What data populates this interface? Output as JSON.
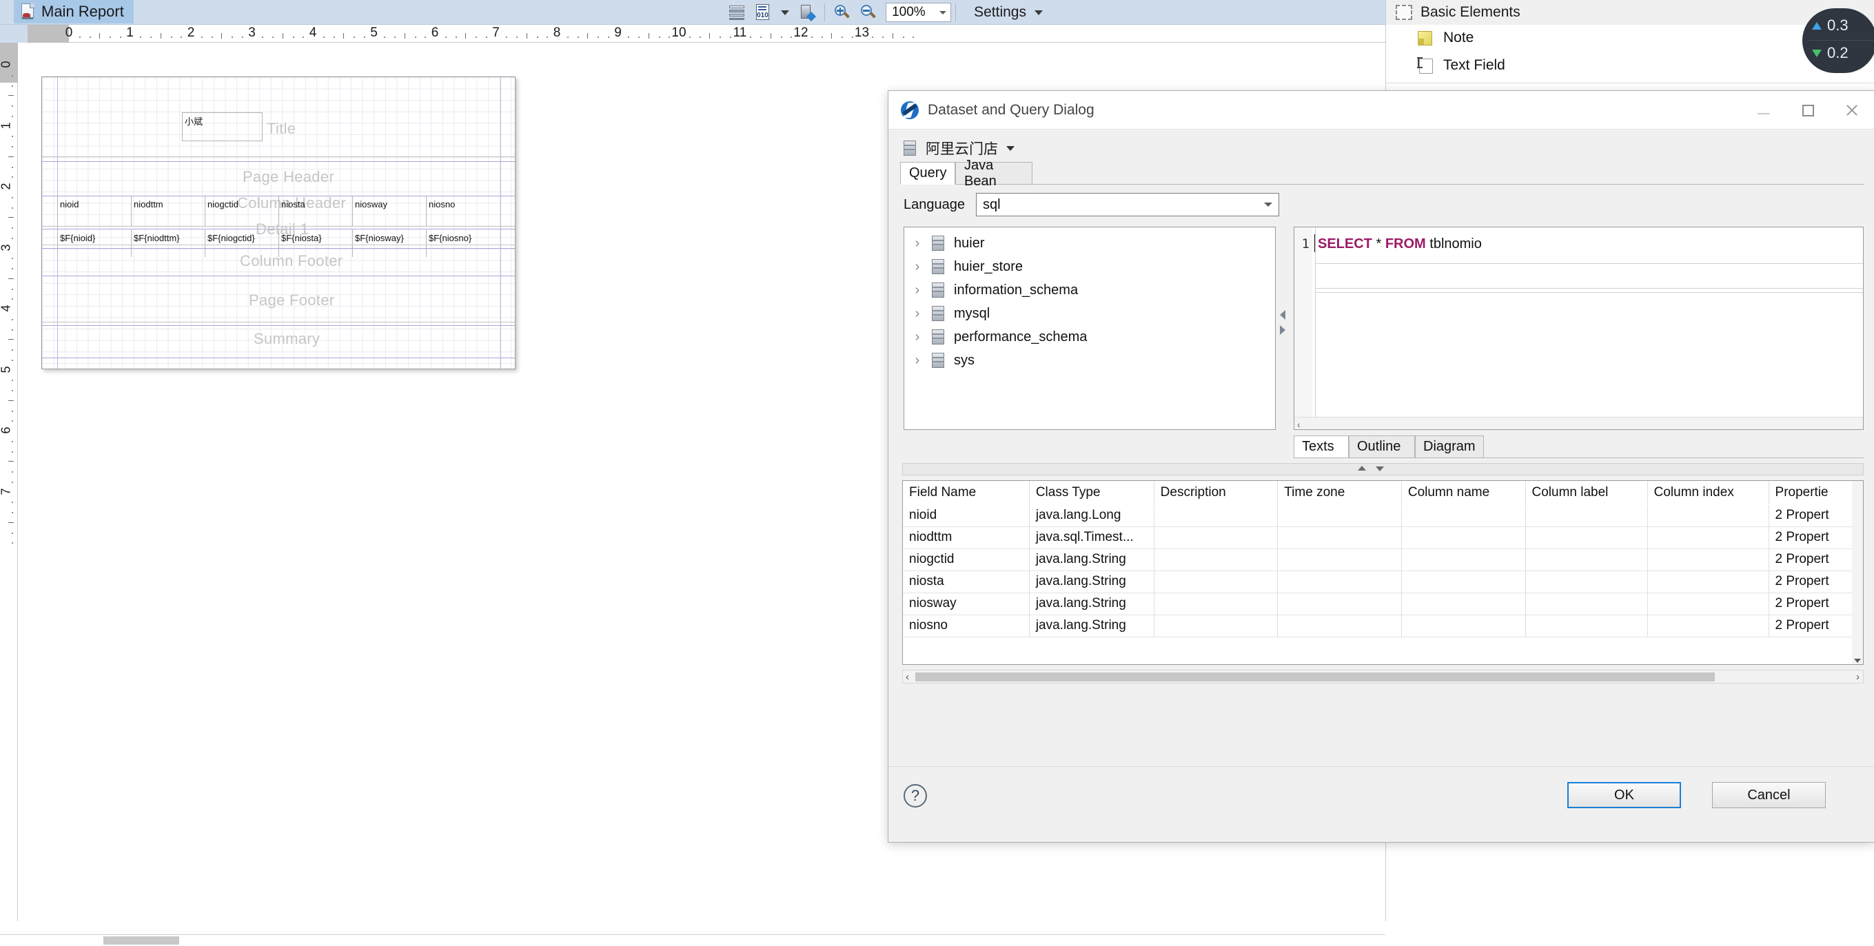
{
  "topbar": {
    "doc_tab_label": "Main Report",
    "doc_tab_icon": "report-document-icon",
    "toolbar_icons": [
      "dataset-rows-icon",
      "data-binary-icon",
      "dropdown-caret-icon",
      "server-edit-icon",
      "zoom-in-icon",
      "zoom-out-icon"
    ],
    "zoom_value": "100%",
    "settings_label": "Settings"
  },
  "designer": {
    "h_ruler_numbers": [
      "0",
      "1",
      "2",
      "3",
      "4",
      "5",
      "6",
      "7",
      "8",
      "9",
      "10",
      "11",
      "12",
      "13"
    ],
    "v_ruler_numbers": [
      "0",
      "1",
      "2",
      "3",
      "4",
      "5",
      "6",
      "7"
    ],
    "bands": [
      {
        "name": "Title",
        "label": "Title"
      },
      {
        "name": "Page Header",
        "label": "Page Header"
      },
      {
        "name": "Column Header",
        "label": "Column Header"
      },
      {
        "name": "Detail 1",
        "label": "Detail 1"
      },
      {
        "name": "Column Footer",
        "label": "Column Footer"
      },
      {
        "name": "Page Footer",
        "label": "Page Footer"
      },
      {
        "name": "Summary",
        "label": "Summary"
      }
    ],
    "title_textbox_value": "小斌",
    "column_headers": [
      "nioid",
      "niodttm",
      "niogctid",
      "niosta",
      "niosway",
      "niosno"
    ],
    "detail_fields": [
      "$F{nioid}",
      "$F{niodttm}",
      "$F{niogctid}",
      "$F{niosta}",
      "$F{niosway}",
      "$F{niosno}"
    ]
  },
  "palette": {
    "section_label": "Basic Elements",
    "section_icon": "dashed-rectangle-icon",
    "items": [
      {
        "label": "Note",
        "icon": "sticky-note-icon"
      },
      {
        "label": "Text Field",
        "icon": "text-field-icon"
      }
    ]
  },
  "net_widget": {
    "upload": "0.3",
    "download": "0.2",
    "up_icon": "arrow-up-icon",
    "down_icon": "arrow-down-icon"
  },
  "dialog": {
    "title": "Dataset and Query Dialog",
    "title_icon": "jasperreports-icon",
    "window_buttons": [
      "minimize-icon",
      "maximize-icon",
      "close-icon"
    ],
    "datasource": {
      "name": "阿里云门店",
      "icon": "database-icon"
    },
    "tabs": [
      {
        "label": "Query",
        "active": true
      },
      {
        "label": "Java Bean",
        "active": false
      }
    ],
    "language": {
      "label": "Language",
      "value": "sql"
    },
    "tree": [
      {
        "label": "huier"
      },
      {
        "label": "huier_store"
      },
      {
        "label": "information_schema"
      },
      {
        "label": "mysql"
      },
      {
        "label": "performance_schema"
      },
      {
        "label": "sys"
      }
    ],
    "sql": {
      "line_number": "1",
      "keyword1": "SELECT",
      "star": " * ",
      "keyword2": "FROM",
      "table": " tblnomio"
    },
    "lower_tabs": [
      {
        "label": "Texts",
        "active": true
      },
      {
        "label": "Outline",
        "active": false
      },
      {
        "label": "Diagram",
        "active": false
      }
    ],
    "field_table": {
      "columns": [
        "Field Name",
        "Class Type",
        "Description",
        "Time zone",
        "Column name",
        "Column label",
        "Column index",
        "Propertie"
      ],
      "rows": [
        {
          "field_name": "nioid",
          "class_type": "java.lang.Long",
          "description": "",
          "time_zone": "",
          "column_name": "",
          "column_label": "",
          "column_index": "",
          "properties": "2 Propert"
        },
        {
          "field_name": "niodttm",
          "class_type": "java.sql.Timest...",
          "description": "",
          "time_zone": "",
          "column_name": "",
          "column_label": "",
          "column_index": "",
          "properties": "2 Propert"
        },
        {
          "field_name": "niogctid",
          "class_type": "java.lang.String",
          "description": "",
          "time_zone": "",
          "column_name": "",
          "column_label": "",
          "column_index": "",
          "properties": "2 Propert"
        },
        {
          "field_name": "niosta",
          "class_type": "java.lang.String",
          "description": "",
          "time_zone": "",
          "column_name": "",
          "column_label": "",
          "column_index": "",
          "properties": "2 Propert"
        },
        {
          "field_name": "niosway",
          "class_type": "java.lang.String",
          "description": "",
          "time_zone": "",
          "column_name": "",
          "column_label": "",
          "column_index": "",
          "properties": "2 Propert"
        },
        {
          "field_name": "niosno",
          "class_type": "java.lang.String",
          "description": "",
          "time_zone": "",
          "column_name": "",
          "column_label": "",
          "column_index": "",
          "properties": "2 Propert"
        }
      ]
    },
    "footer": {
      "help_label": "?",
      "ok_label": "OK",
      "cancel_label": "Cancel"
    }
  }
}
